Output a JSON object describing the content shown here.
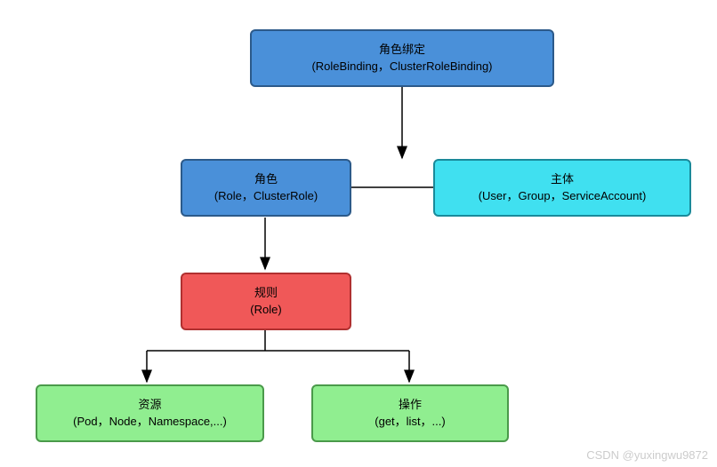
{
  "nodes": {
    "rolebinding": {
      "title": "角色绑定",
      "subtitle": "(RoleBinding，ClusterRoleBinding)"
    },
    "role": {
      "title": "角色",
      "subtitle": "(Role，ClusterRole)"
    },
    "subject": {
      "title": "主体",
      "subtitle": "(User，Group，ServiceAccount)"
    },
    "rule": {
      "title": "规则",
      "subtitle": "(Role)"
    },
    "resource": {
      "title": "资源",
      "subtitle": "(Pod，Node，Namespace,...)"
    },
    "operation": {
      "title": "操作",
      "subtitle": "(get，list，...)"
    }
  },
  "watermark": "CSDN @yuxingwu9872"
}
